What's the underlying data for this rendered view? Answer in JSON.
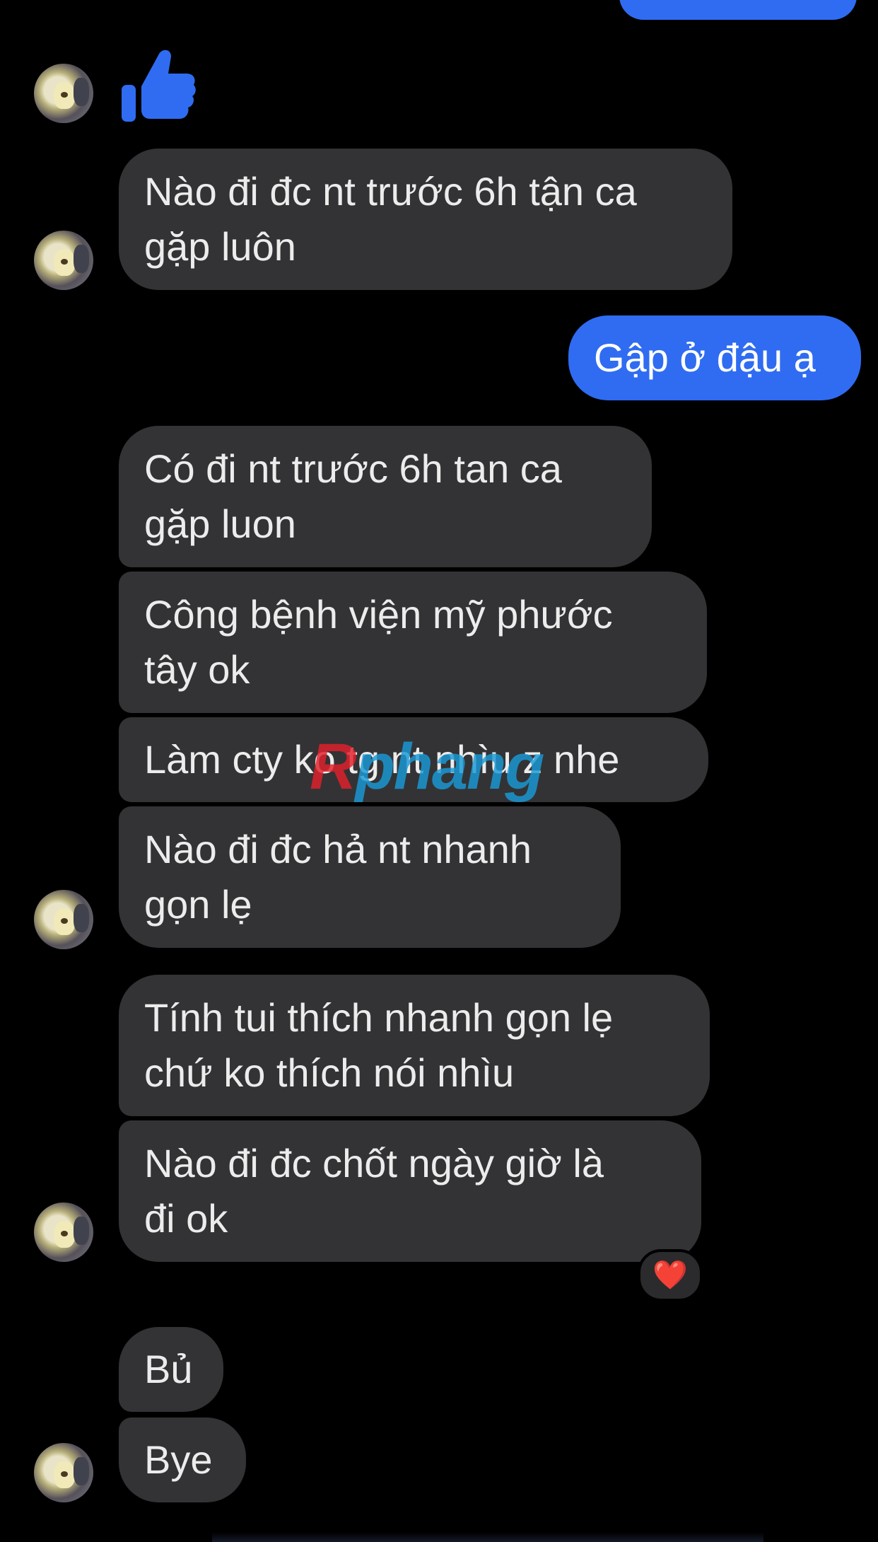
{
  "messages": [
    {
      "text": "Nào đi đc nt trước 6h tận ca\ngặp luôn"
    },
    {
      "text": "Gập ở đậu ạ"
    },
    {
      "text": "Có đi nt trước 6h tan ca\ngặp luon"
    },
    {
      "text": "Công bệnh viện mỹ phước\ntây ok"
    },
    {
      "text": "Làm cty ko tg nt nhìu z nhe"
    },
    {
      "text": "Nào đi đc hả nt nhanh\ngọn lẹ"
    },
    {
      "text": "Tính tui thích nhanh gọn lẹ\nchứ ko thích nói nhìu"
    },
    {
      "text": "Nào đi đc chốt ngày giờ là\nđi ok"
    },
    {
      "text": "Bủ"
    },
    {
      "text": "Bye"
    }
  ],
  "reactions": {
    "heart": "❤️",
    "heart_icon": "heart-icon",
    "like_icon": "thumbs-up-icon"
  },
  "watermark": {
    "first_letter": "R",
    "rest": "phang"
  },
  "colors": {
    "background": "#000000",
    "received_bubble": "#333335",
    "sent_bubble": "#2f6cf1",
    "like": "#2f6cf1"
  }
}
